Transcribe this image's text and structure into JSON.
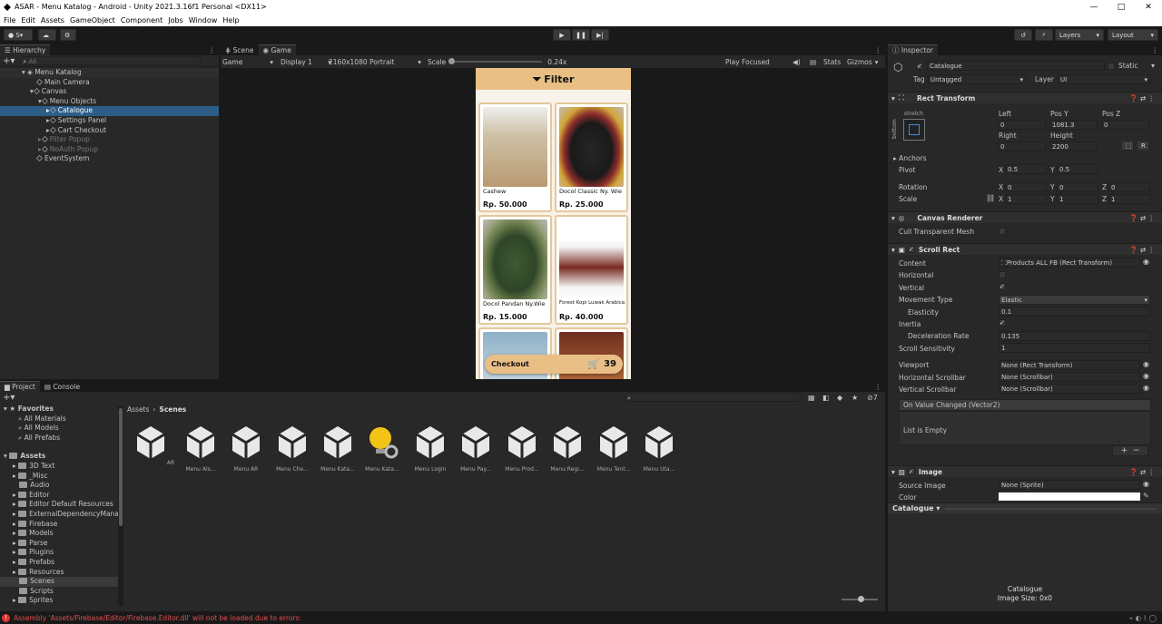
{
  "window": {
    "title": "ASAR - Menu Katalog - Android - Unity 2021.3.16f1 Personal <DX11>"
  },
  "menu": [
    "File",
    "Edit",
    "Assets",
    "GameObject",
    "Component",
    "Jobs",
    "Window",
    "Help"
  ],
  "toolbar": {
    "account": "S",
    "layers": "Layers",
    "layout": "Layout"
  },
  "hierarchy": {
    "tab": "Hierarchy",
    "search_placeholder": "All",
    "items": [
      {
        "label": "Menu Katalog"
      },
      {
        "label": "Main Camera"
      },
      {
        "label": "Canvas"
      },
      {
        "label": "Menu Objects"
      },
      {
        "label": "Catalogue"
      },
      {
        "label": "Settings Panel"
      },
      {
        "label": "Cart Checkout"
      },
      {
        "label": "Filter Popup"
      },
      {
        "label": "NoAuth Popup"
      },
      {
        "label": "EventSystem"
      }
    ]
  },
  "game_view": {
    "tabs": [
      "Scene",
      "Game"
    ],
    "mode": "Game",
    "display": "Display 1",
    "resolution": "2160x1080 Portrait",
    "scale_label": "Scale",
    "scale_value": "0.24x",
    "play_focused": "Play Focused",
    "stats": "Stats",
    "gizmos": "Gizmos"
  },
  "app": {
    "filter_label": "Filter",
    "products": [
      {
        "name": "Cashew",
        "price": "Rp. 50.000"
      },
      {
        "name": "Docol Classic Ny. Wie",
        "price": "Rp. 25.000"
      },
      {
        "name": "Docol Pandan Ny.Wie",
        "price": "Rp. 15.000"
      },
      {
        "name": "Forest Kopi Luwak Arabica",
        "price": "Rp. 40.000"
      }
    ],
    "checkout_label": "Checkout",
    "cart_count": "39"
  },
  "project": {
    "tabs": [
      "Project",
      "Console"
    ],
    "favorites_label": "Favorites",
    "favorites": [
      "All Materials",
      "All Models",
      "All Prefabs"
    ],
    "assets_label": "Assets",
    "folders": [
      "3D Text",
      "_Misc",
      "Audio",
      "Editor",
      "Editor Default Resources",
      "ExternalDependencyMana",
      "Firebase",
      "Models",
      "Parse",
      "Plugins",
      "Prefabs",
      "Resources",
      "Scenes",
      "Scripts",
      "Sprites"
    ],
    "breadcrumb": [
      "Assets",
      "Scenes"
    ],
    "hidden_count": "7",
    "scenes": [
      "AR",
      "Menu Als...",
      "Menu AR",
      "Menu Che...",
      "Menu Kata...",
      "Menu Kata...",
      "Menu Login",
      "Menu Pay...",
      "Menu Prod...",
      "Menu Regi...",
      "Menu Tent...",
      "Menu Uta..."
    ]
  },
  "inspector": {
    "tab": "Inspector",
    "object_name": "Catalogue",
    "static_label": "Static",
    "tag_label": "Tag",
    "tag_value": "Untagged",
    "layer_label": "Layer",
    "layer_value": "UI",
    "rect_transform": {
      "title": "Rect Transform",
      "stretch": "stretch",
      "bottom": "bottom",
      "left_label": "Left",
      "left": "0",
      "posy_label": "Pos Y",
      "posy": "1081.3",
      "posz_label": "Pos Z",
      "posz": "0",
      "right_label": "Right",
      "right": "0",
      "height_label": "Height",
      "height": "2200",
      "anchors": "Anchors",
      "pivot_label": "Pivot",
      "pivot_x": "0.5",
      "pivot_y": "0.5",
      "rotation_label": "Rotation",
      "rot_x": "0",
      "rot_y": "0",
      "rot_z": "0",
      "scale_label": "Scale",
      "scale_x": "1",
      "scale_y": "1",
      "scale_z": "1"
    },
    "canvas_renderer": {
      "title": "Canvas Renderer",
      "cull_label": "Cull Transparent Mesh"
    },
    "scroll_rect": {
      "title": "Scroll Rect",
      "content_label": "Content",
      "content": "Products ALL FB (Rect Transform)",
      "horizontal_label": "Horizontal",
      "vertical_label": "Vertical",
      "movement_label": "Movement Type",
      "movement": "Elastic",
      "elasticity_label": "Elasticity",
      "elasticity": "0.1",
      "inertia_label": "Inertia",
      "decel_label": "Deceleration Rate",
      "decel": "0.135",
      "sensitivity_label": "Scroll Sensitivity",
      "sensitivity": "1",
      "viewport_label": "Viewport",
      "viewport": "None (Rect Transform)",
      "hscroll_label": "Horizontal Scrollbar",
      "hscroll": "None (Scrollbar)",
      "vscroll_label": "Vertical Scrollbar",
      "vscroll": "None (Scrollbar)",
      "event_label": "On Value Changed (Vector2)",
      "event_empty": "List is Empty"
    },
    "image": {
      "title": "Image",
      "source_label": "Source Image",
      "source": "None (Sprite)",
      "color_label": "Color"
    },
    "preview_dropdown": "Catalogue",
    "preview_name": "Catalogue",
    "preview_size": "Image Size: 0x0"
  },
  "status": {
    "error": "Assembly 'Assets/Firebase/Editor/Firebase.Editor.dll' will not be loaded due to errors:"
  }
}
